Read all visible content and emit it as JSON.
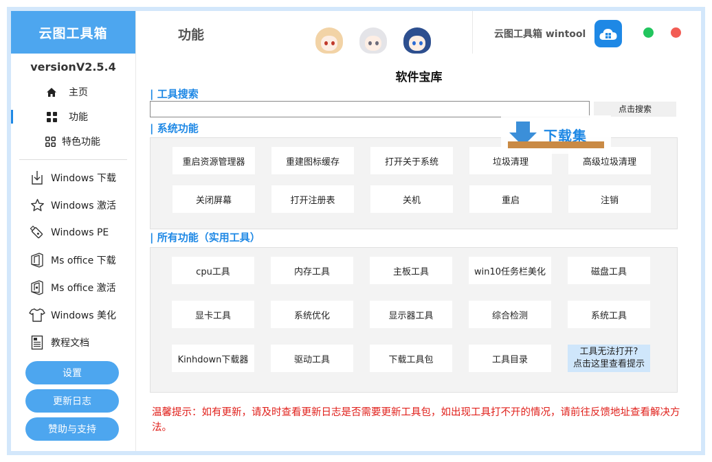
{
  "sidebar": {
    "brand": "云图工具箱",
    "version": "versionV2.5.4",
    "nav": [
      {
        "label": "主页",
        "icon": "home-icon"
      },
      {
        "label": "功能",
        "icon": "grid-icon",
        "active": true
      },
      {
        "label": "特色功能",
        "icon": "apps-icon"
      }
    ],
    "extra": [
      {
        "label": "Windows 下载",
        "icon": "download-icon"
      },
      {
        "label": "Windows 激活",
        "icon": "star-icon"
      },
      {
        "label": "Windows PE",
        "icon": "usb-icon"
      },
      {
        "label": "Ms office 下载",
        "icon": "office-icon"
      },
      {
        "label": "Ms office 激活",
        "icon": "office-key-icon"
      },
      {
        "label": "Windows 美化",
        "icon": "tshirt-icon"
      },
      {
        "label": "教程文档",
        "icon": "document-icon"
      }
    ],
    "buttons": {
      "settings": "设置",
      "changelog": "更新日志",
      "support": "赞助与支持"
    }
  },
  "header": {
    "page_title": "功能",
    "app_name": "云图工具箱 wintool",
    "colors": {
      "accent": "#4da6ef",
      "green_dot": "#22c55e",
      "red_dot": "#f25c54"
    }
  },
  "main": {
    "title": "软件宝库",
    "search": {
      "section": "| 工具搜索",
      "value": "",
      "button": "点击搜索"
    },
    "system": {
      "section": "| 系统功能",
      "tools": [
        "重启资源管理器",
        "重建图标缓存",
        "打开关于系统",
        "垃圾清理",
        "高级垃圾清理",
        "关闭屏幕",
        "打开注册表",
        "关机",
        "重启",
        "注销"
      ]
    },
    "all": {
      "section": "| 所有功能（实用工具）",
      "tools": [
        "cpu工具",
        "内存工具",
        "主板工具",
        "win10任务栏美化",
        "磁盘工具",
        "显卡工具",
        "系统优化",
        "显示器工具",
        "综合检测",
        "系统工具",
        "Kinhdown下载器",
        "驱动工具",
        "下载工具包",
        "工具目录"
      ],
      "help_line1": "工具无法打开?",
      "help_line2": "点击这里查看提示"
    },
    "tip": "温馨提示：如有更新，请及时查看更新日志是否需要更新工具包，如出现工具打不开的情况，请前往反馈地址查看解决方法。",
    "watermark": "下载集"
  }
}
